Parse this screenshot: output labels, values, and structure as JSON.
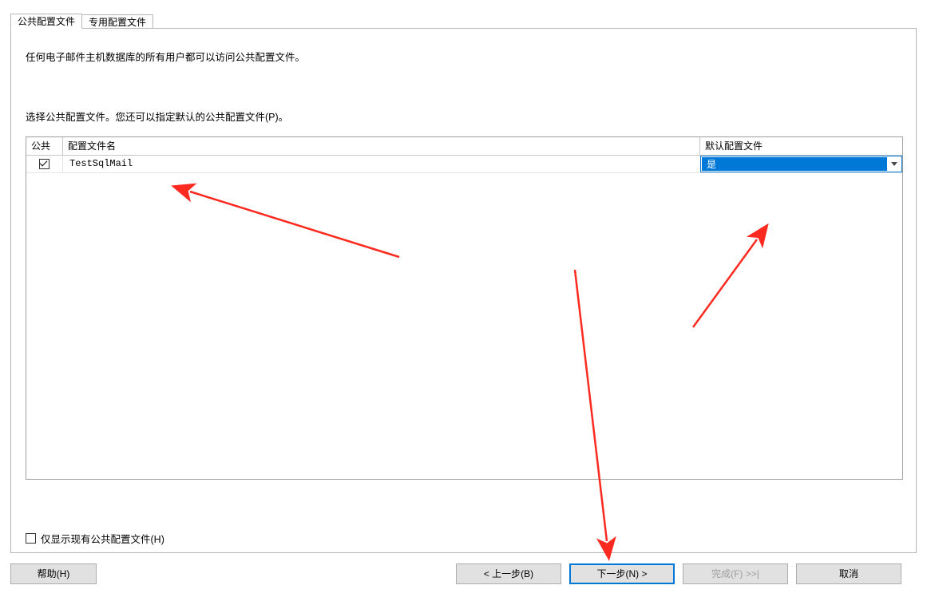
{
  "tabs": {
    "public": "公共配置文件",
    "private": "专用配置文件"
  },
  "content": {
    "desc1": "任何电子邮件主机数据库的所有用户都可以访问公共配置文件。",
    "desc2": "选择公共配置文件。您还可以指定默认的公共配置文件(P)。"
  },
  "grid": {
    "headers": {
      "public": "公共",
      "name": "配置文件名",
      "default": "默认配置文件"
    },
    "rows": [
      {
        "public_checked": true,
        "name": "TestSqlMail",
        "default_value": "是"
      }
    ]
  },
  "only_existing_label": "仅显示现有公共配置文件(H)",
  "buttons": {
    "help": "帮助(H)",
    "back": "< 上一步(B)",
    "next": "下一步(N) >",
    "finish": "完成(F) >>|",
    "cancel": "取消"
  }
}
